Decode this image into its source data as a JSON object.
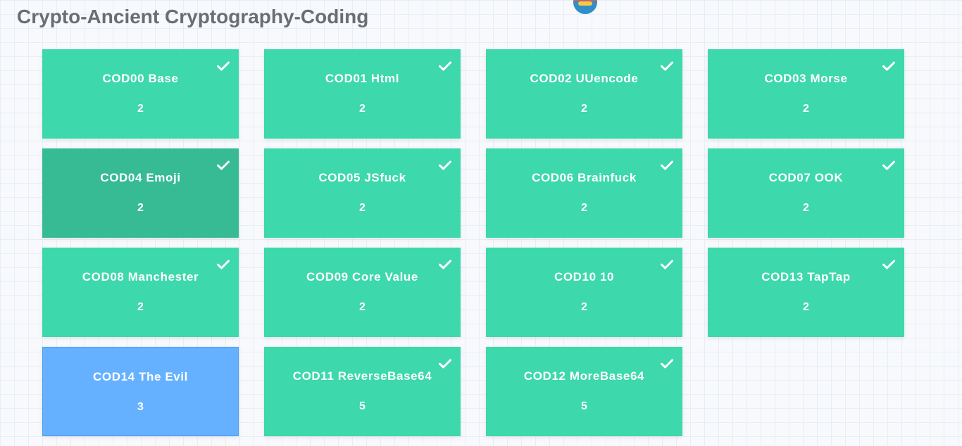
{
  "page": {
    "title": "Crypto-Ancient Cryptography-Coding"
  },
  "challenges": [
    {
      "name": "COD00 Base",
      "value": "2",
      "solved": true,
      "state": "solved"
    },
    {
      "name": "COD01 Html",
      "value": "2",
      "solved": true,
      "state": "solved"
    },
    {
      "name": "COD02 UUencode",
      "value": "2",
      "solved": true,
      "state": "solved"
    },
    {
      "name": "COD03 Morse",
      "value": "2",
      "solved": true,
      "state": "solved"
    },
    {
      "name": "COD04 Emoji",
      "value": "2",
      "solved": true,
      "state": "hover"
    },
    {
      "name": "COD05 JSfuck",
      "value": "2",
      "solved": true,
      "state": "solved"
    },
    {
      "name": "COD06 Brainfuck",
      "value": "2",
      "solved": true,
      "state": "solved"
    },
    {
      "name": "COD07 OOK",
      "value": "2",
      "solved": true,
      "state": "solved"
    },
    {
      "name": "COD08 Manchester",
      "value": "2",
      "solved": true,
      "state": "solved"
    },
    {
      "name": "COD09 Core Value",
      "value": "2",
      "solved": true,
      "state": "solved"
    },
    {
      "name": "COD10 10",
      "value": "2",
      "solved": true,
      "state": "solved"
    },
    {
      "name": "COD13 TapTap",
      "value": "2",
      "solved": true,
      "state": "solved"
    },
    {
      "name": "COD14 The Evil",
      "value": "3",
      "solved": false,
      "state": "unsolved"
    },
    {
      "name": "COD11 ReverseBase64",
      "value": "5",
      "solved": true,
      "state": "solved"
    },
    {
      "name": "COD12 MoreBase64",
      "value": "5",
      "solved": true,
      "state": "solved"
    }
  ],
  "colors": {
    "solved": "#3dd8ab",
    "hover": "#37bb95",
    "unsolved": "#66b1ff",
    "title": "#6a6e73"
  },
  "icons": {
    "solved_marker": "check-icon",
    "logo": "site-logo-icon"
  }
}
